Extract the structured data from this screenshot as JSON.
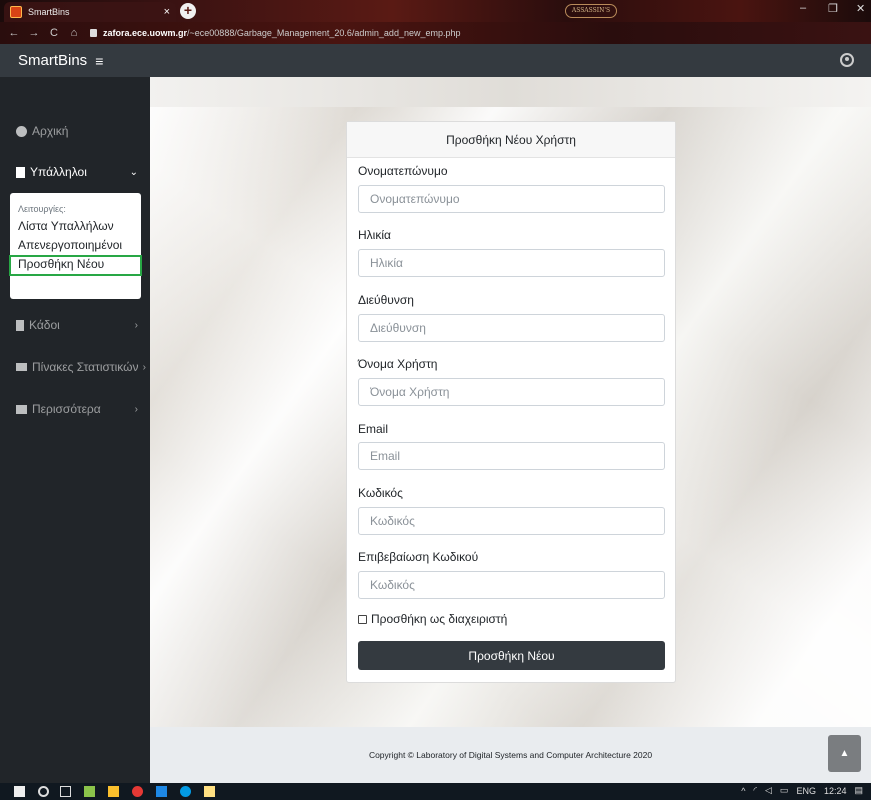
{
  "browser": {
    "tab_title": "SmartBins",
    "tab_close": "×",
    "new_tab": "+",
    "badge_text": "ASSASSIN'S",
    "url_host": "zafora.ece.uowm.gr",
    "url_path": "/~ece00888/Garbage_Management_20.6/admin_add_new_emp.php",
    "nav": {
      "back": "←",
      "forward": "→",
      "reload": "C",
      "home": "⌂"
    },
    "window": {
      "minimize": "–",
      "maximize": "❐",
      "close": "✕"
    }
  },
  "topnav": {
    "brand": "SmartBins",
    "menu_glyph": "≡"
  },
  "sidebar": {
    "items": [
      {
        "label": "Αρχική",
        "icon": "dashboard-icon",
        "chevron": ""
      },
      {
        "label": "Υπάλληλοι",
        "icon": "employees-icon",
        "chevron": "⌄"
      },
      {
        "label": "Κάδοι",
        "icon": "bin-icon",
        "chevron": "›"
      },
      {
        "label": "Πίνακες Στατιστικών",
        "icon": "chart-icon",
        "chevron": "›"
      },
      {
        "label": "Περισσότερα",
        "icon": "more-icon",
        "chevron": "›"
      }
    ],
    "submenu": {
      "header": "Λειτουργίες:",
      "items": [
        "Λίστα Υπαλλήλων",
        "Απενεργοποιημένοι",
        "Προσθήκη Νέου"
      ]
    }
  },
  "form": {
    "title": "Προσθήκη Νέου Χρήστη",
    "fields": [
      {
        "label": "Ονοματεπώνυμο",
        "placeholder": "Ονοματεπώνυμο"
      },
      {
        "label": "Ηλικία",
        "placeholder": "Ηλικία"
      },
      {
        "label": "Διεύθυνση",
        "placeholder": "Διεύθυνση"
      },
      {
        "label": "Όνομα Χρήστη",
        "placeholder": "Όνομα Χρήστη"
      },
      {
        "label": "Email",
        "placeholder": "Email"
      },
      {
        "label": "Κωδικός",
        "placeholder": "Κωδικός"
      },
      {
        "label": "Επιβεβαίωση Κωδικού",
        "placeholder": "Κωδικός"
      }
    ],
    "admin_checkbox_label": "Προσθήκη ως διαχειριστή",
    "submit_label": "Προσθήκη Νέου"
  },
  "footer": {
    "copyright": "Copyright © Laboratory of Digital Systems and Computer Architecture 2020",
    "scroll_top_glyph": "▲"
  },
  "taskbar": {
    "lang": "ENG",
    "time": "12:24"
  },
  "colors": {
    "navbar": "#343a40",
    "sidebar": "#212529",
    "highlight": "#28a745",
    "footer": "#e9ecef"
  }
}
